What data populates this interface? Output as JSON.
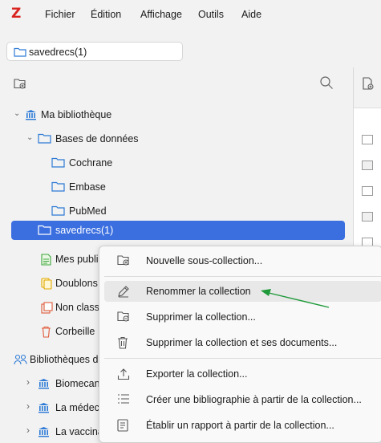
{
  "app": {
    "logo": "Z"
  },
  "menubar": {
    "items": [
      "Fichier",
      "Édition",
      "Affichage",
      "Outils",
      "Aide"
    ]
  },
  "tab": {
    "title": "savedrecs(1)"
  },
  "tree": {
    "library": "Ma bibliothèque",
    "databases": "Bases de données",
    "cochrane": "Cochrane",
    "embase": "Embase",
    "pubmed": "PubMed",
    "savedrecs": "savedrecs(1)",
    "publications": "Mes publications",
    "duplicates": "Doublons",
    "unfiled": "Non classés",
    "trash": "Corbeille",
    "group_libraries": "Bibliothèques de groupe",
    "groups": [
      "Biomecanique",
      "La médecine",
      "La vaccination"
    ]
  },
  "context_menu": {
    "items": [
      "Nouvelle sous-collection...",
      "Renommer la collection",
      "Supprimer la collection...",
      "Supprimer la collection et ses documents...",
      "Exporter la collection...",
      "Créer une bibliographie à partir de la collection...",
      "Établir un rapport à partir de la collection..."
    ]
  },
  "colors": {
    "accent": "#3b6fe0",
    "folder": "#2d7ad6",
    "annotation_arrow": "#1f9a3a",
    "logo": "#d8231f"
  }
}
